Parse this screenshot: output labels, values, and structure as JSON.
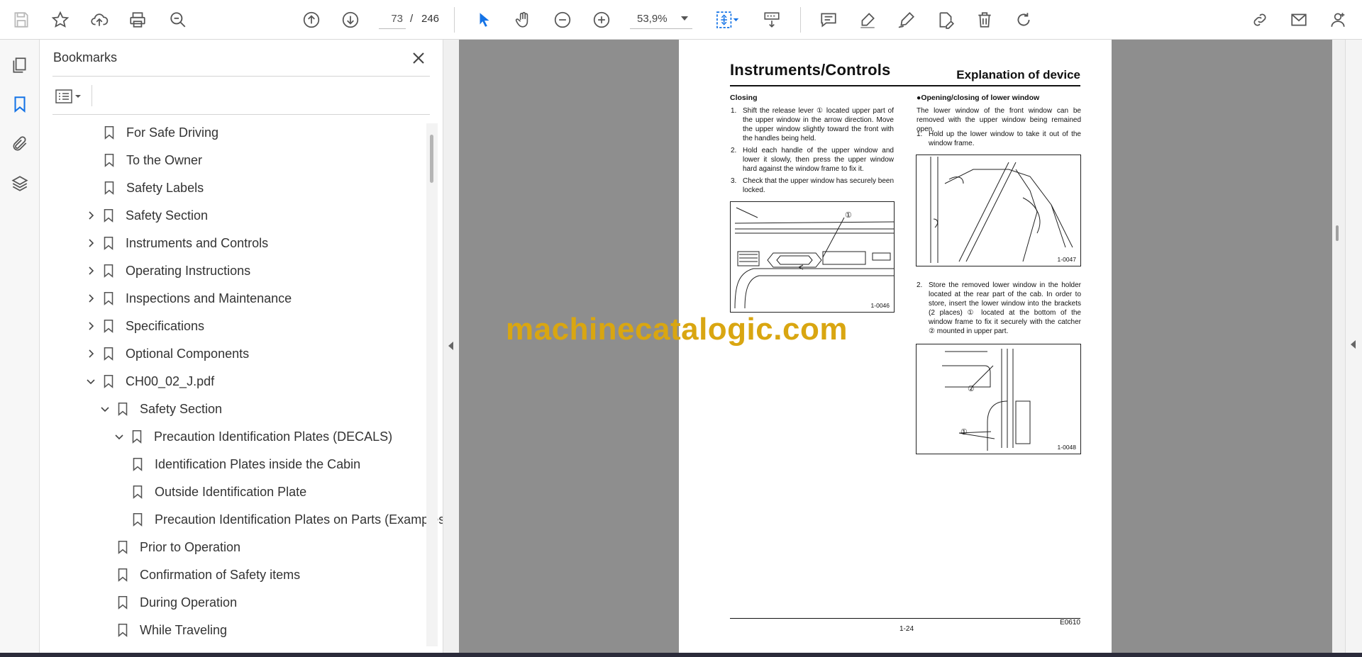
{
  "toolbar": {
    "current_page": "73",
    "page_separator": "/",
    "total_pages": "246",
    "zoom": "53,9%"
  },
  "bookmarks": {
    "title": "Bookmarks",
    "items": [
      {
        "label": "For Safe Driving",
        "twisty": "none"
      },
      {
        "label": "To the Owner",
        "twisty": "none"
      },
      {
        "label": "Safety Labels",
        "twisty": "none"
      },
      {
        "label": "Safety Section",
        "twisty": "collapsed"
      },
      {
        "label": "Instruments and Controls",
        "twisty": "collapsed"
      },
      {
        "label": "Operating Instructions",
        "twisty": "collapsed"
      },
      {
        "label": "Inspections and Maintenance",
        "twisty": "collapsed"
      },
      {
        "label": "Specifications",
        "twisty": "collapsed"
      },
      {
        "label": "Optional Components",
        "twisty": "collapsed"
      },
      {
        "label": "CH00_02_J.pdf",
        "twisty": "expanded"
      },
      {
        "label": "Safety Section",
        "twisty": "expanded"
      },
      {
        "label": "Precaution Identification Plates (DECALS)",
        "twisty": "expanded"
      },
      {
        "label": "Identification Plates inside the Cabin",
        "twisty": "none"
      },
      {
        "label": "Outside Identification Plate",
        "twisty": "none"
      },
      {
        "label": "Precaution Identification Plates on Parts (Examples)",
        "twisty": "none"
      },
      {
        "label": "Prior to Operation",
        "twisty": "none"
      },
      {
        "label": "Confirmation of Safety items",
        "twisty": "none"
      },
      {
        "label": "During Operation",
        "twisty": "none"
      },
      {
        "label": "While Traveling",
        "twisty": "none"
      }
    ]
  },
  "document": {
    "title": "Instruments/Controls",
    "section": "Explanation of device",
    "left_heading": "Closing",
    "left_steps": [
      {
        "n": "1.",
        "text": "Shift the release lever ① located upper part of the upper window in the arrow direction. Move the upper window slightly toward the front with the handles being held."
      },
      {
        "n": "2.",
        "text": "Hold each handle of the upper window and lower it slowly, then press the upper window hard against the window frame to fix it."
      },
      {
        "n": "3.",
        "text": "Check that the upper window has securely been locked."
      }
    ],
    "fig_left": "1-0046",
    "right_heading": "●Opening/closing of lower window",
    "right_intro": "The lower window of the front window can be removed with the upper window being remained open.",
    "right_steps": [
      {
        "n": "1.",
        "text": "Hold up the lower window to take it out of the window frame."
      },
      {
        "n": "2.",
        "text": "Store the removed lower window in the holder located at the rear part of the cab. In order to store, insert the lower window into the brackets (2 places) ① located at the bottom of the window frame to fix it securely with the catcher ② mounted in upper part."
      }
    ],
    "fig_right_top": "1-0047",
    "fig_right_bottom": "1-0048",
    "callout_1": "①",
    "callout_2": "②",
    "page_number": "1-24",
    "doc_code": "E0610"
  },
  "watermark": "machinecatalogic.com",
  "colors": {
    "accent": "#1473e6",
    "watermark": "#d9a611",
    "canvas": "#8e8e8e"
  }
}
